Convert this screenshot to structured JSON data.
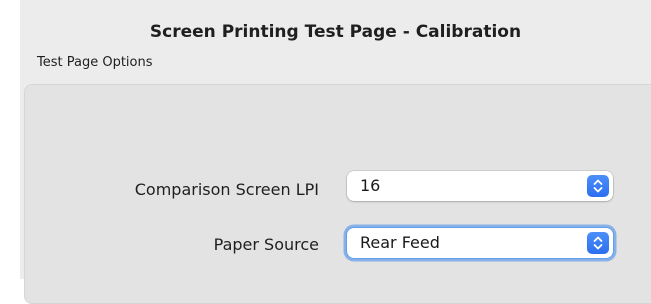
{
  "window": {
    "title": "Screen Printing Test Page - Calibration"
  },
  "section": {
    "label": "Test Page Options"
  },
  "fields": {
    "comparison_lpi": {
      "label": "Comparison Screen LPI",
      "value": "16"
    },
    "paper_source": {
      "label": "Paper Source",
      "value": "Rear Feed",
      "focused": true
    }
  },
  "icons": {
    "popup_stepper": "up-down-chevron-icon"
  },
  "colors": {
    "accent": "#3478f6",
    "focus_ring": "#67a0eb",
    "dialog_bg": "#ececec",
    "group_bg": "#e3e3e3"
  }
}
